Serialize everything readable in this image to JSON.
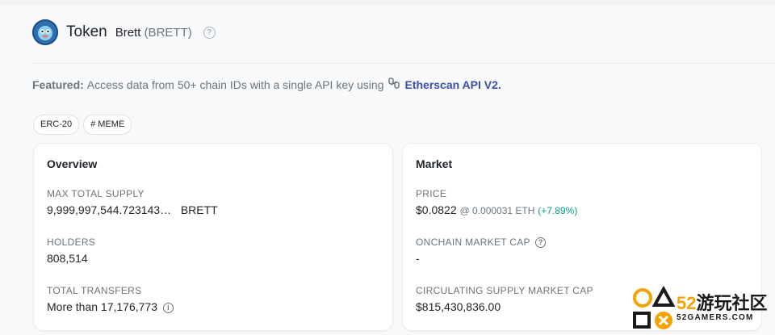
{
  "header": {
    "title": "Token",
    "token_name": "Brett",
    "token_symbol": "(BRETT)",
    "help_glyph": "?"
  },
  "featured": {
    "label": "Featured:",
    "text": "Access data from 50+ chain IDs with a single API key using",
    "link_text": "Etherscan API V2."
  },
  "tags": [
    "ERC-20",
    "# MEME"
  ],
  "overview": {
    "title": "Overview",
    "max_supply_label": "MAX TOTAL SUPPLY",
    "max_supply_value": "9,999,997,544.723143…",
    "max_supply_unit": "BRETT",
    "holders_label": "HOLDERS",
    "holders_value": "808,514",
    "transfers_label": "TOTAL TRANSFERS",
    "transfers_value": "More than 17,176,773"
  },
  "market": {
    "title": "Market",
    "price_label": "PRICE",
    "price_value": "$0.0822",
    "price_eth": "@ 0.000031 ETH",
    "price_change": "(+7.89%)",
    "onchain_cap_label": "ONCHAIN MARKET CAP",
    "onchain_cap_value": "-",
    "circ_cap_label": "CIRCULATING SUPPLY MARKET CAP",
    "circ_cap_value": "$815,430,836.00"
  },
  "watermark": {
    "brand_number": "52",
    "brand_cn": "游玩社区",
    "brand_url": "52GAMERS.COM"
  },
  "colors": {
    "accent_link": "#3d4eac",
    "positive": "#00a186",
    "logo_bg": "#2f6fb0"
  }
}
